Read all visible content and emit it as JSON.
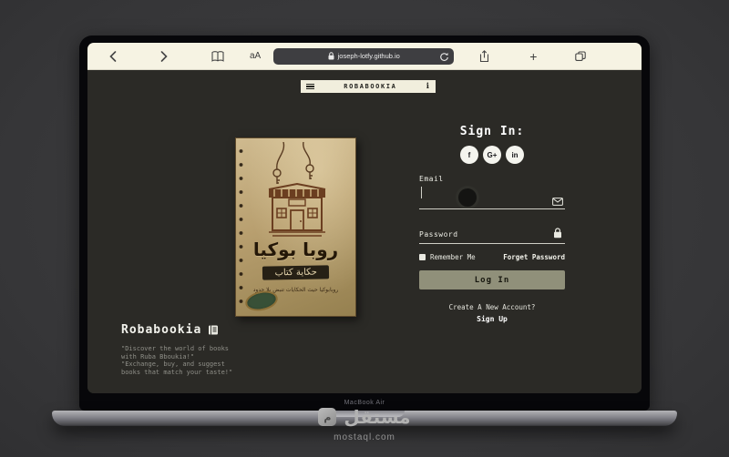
{
  "browser": {
    "reader_label": "aA",
    "url": "joseph-lotfy.github.io",
    "new_tab_label": "+"
  },
  "site": {
    "navbar": {
      "brand": "ROBABOOKIA",
      "info_label": "i"
    },
    "cover": {
      "title": "روبا بوكيا",
      "band": "حكاية كتاب",
      "tagline": "روبابوكيا حيث الحكايات تنبض بلا حدود"
    },
    "brand": {
      "title": "Robabookia",
      "quotes": [
        "\"Discover the world of books",
        "with Ruba Bboukia!\"",
        "\"Exchange, buy, and suggest",
        "books that match your taste!\""
      ]
    },
    "signin": {
      "heading": "Sign In:",
      "social": [
        "f",
        "G+",
        "in"
      ],
      "email_label": "Email",
      "password_label": "Password",
      "remember_label": "Remember Me",
      "forget_label": "Forget Password",
      "login_label": "Log In",
      "create_label": "Create A New Account?",
      "signup_label": "Sign Up"
    }
  },
  "device": {
    "label": "MacBook Air"
  },
  "watermark": {
    "name": "مستقل",
    "domain": "mostaql.com"
  },
  "colors": {
    "accent_button": "#90907a",
    "page_bg": "#2b2a26",
    "toolbar_bg": "#f6f3e3"
  }
}
